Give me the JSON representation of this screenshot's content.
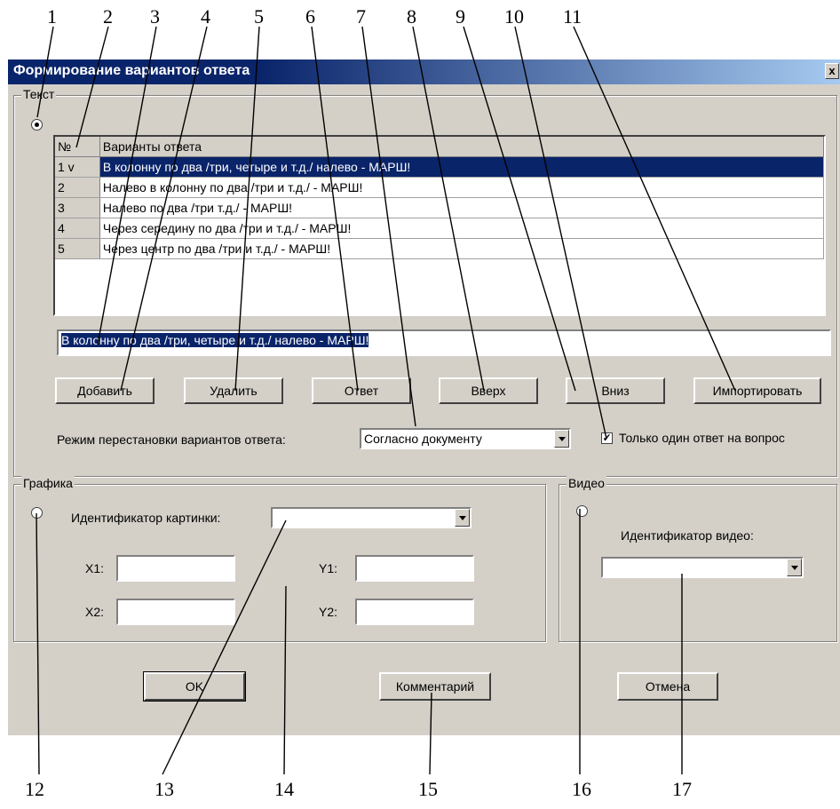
{
  "callouts": {
    "top": [
      "1",
      "2",
      "3",
      "4",
      "5",
      "6",
      "7",
      "8",
      "9",
      "10",
      "11"
    ],
    "bottom": [
      "12",
      "13",
      "14",
      "15",
      "16",
      "17"
    ]
  },
  "dialog": {
    "title": "Формирование вариантов ответа",
    "close_label": "x",
    "text_group": {
      "legend": "Текст",
      "selected": true,
      "grid": {
        "headers": [
          "№",
          "Варианты ответа"
        ],
        "rows": [
          {
            "num": "1 v",
            "text": "В колонну по два /три, четыре и т.д./ налево - МАРШ!",
            "selected": true
          },
          {
            "num": "2",
            "text": "Налево в колонну по два /три и т.д./ - МАРШ!",
            "selected": false
          },
          {
            "num": "3",
            "text": "Налево по два /три т.д./ - МАРШ!",
            "selected": false
          },
          {
            "num": "4",
            "text": "Через середину по два /три и т.д./ - МАРШ!",
            "selected": false
          },
          {
            "num": "5",
            "text": "Через центр по два /три и т.д./ - МАРШ!",
            "selected": false
          }
        ]
      },
      "edit_value": "В колонну по два /три, четыре и т.д./ налево - МАРШ!",
      "buttons": {
        "add": "Добавить",
        "delete": "Удалить",
        "answer": "Ответ",
        "up": "Вверх",
        "down": "Вниз",
        "import": "Импортировать"
      },
      "shuffle_label": "Режим перестановки вариантов ответа:",
      "shuffle_value": "Согласно документу",
      "single_answer_label": "Только один ответ на вопрос",
      "single_answer_checked": true
    },
    "graphics_group": {
      "legend": "Графика",
      "picture_id_label": "Идентификатор картинки:",
      "picture_id_value": "",
      "x1_label": "X1:",
      "x2_label": "X2:",
      "y1_label": "Y1:",
      "y2_label": "Y2:"
    },
    "video_group": {
      "legend": "Видео",
      "video_id_label": "Идентификатор видео:",
      "video_id_value": ""
    },
    "footer": {
      "ok": "OK",
      "comment": "Комментарий",
      "cancel": "Отмена"
    }
  }
}
